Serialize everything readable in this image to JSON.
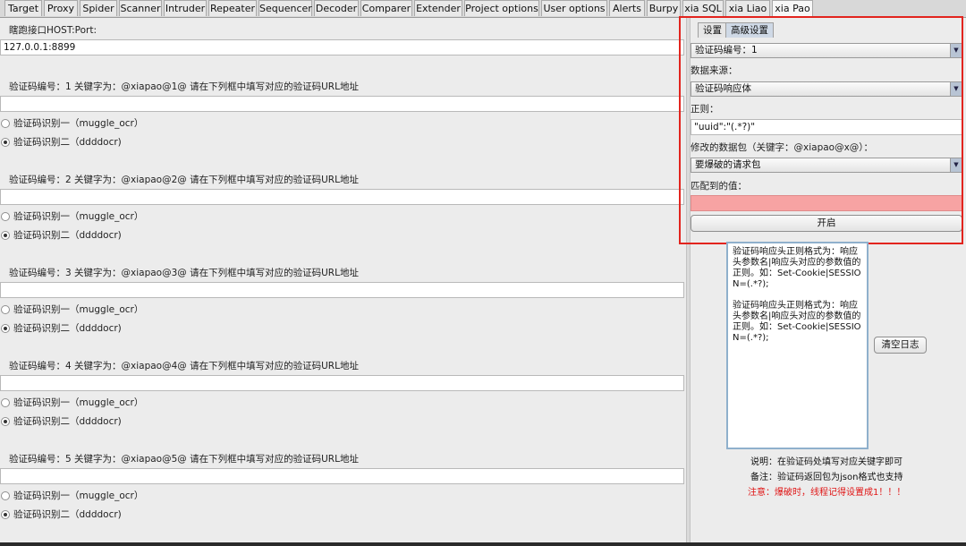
{
  "tabs": [
    "Target",
    "Proxy",
    "Spider",
    "Scanner",
    "Intruder",
    "Repeater",
    "Sequencer",
    "Decoder",
    "Comparer",
    "Extender",
    "Project options",
    "User options",
    "Alerts",
    "Burpy",
    "xia SQL",
    "xia Liao",
    "xia Pao"
  ],
  "active_tab": "xia Pao",
  "left": {
    "host_label": "瞎跑接口HOST:Port:",
    "host_value": "127.0.0.1:8899",
    "sections": [
      {
        "title": "验证码编号：1  关键字为：@xiapao@1@    请在下列框中填写对应的验证码URL地址",
        "url": "",
        "opt1": "验证码识别一（muggle_ocr）",
        "opt2": "验证码识别二（ddddocr)"
      },
      {
        "title": "验证码编号：2  关键字为：@xiapao@2@    请在下列框中填写对应的验证码URL地址",
        "url": "",
        "opt1": "验证码识别一（muggle_ocr）",
        "opt2": "验证码识别二（ddddocr)"
      },
      {
        "title": "验证码编号：3  关键字为：@xiapao@3@    请在下列框中填写对应的验证码URL地址",
        "url": "",
        "opt1": "验证码识别一（muggle_ocr）",
        "opt2": "验证码识别二（ddddocr)"
      },
      {
        "title": "验证码编号：4  关键字为：@xiapao@4@    请在下列框中填写对应的验证码URL地址",
        "url": "",
        "opt1": "验证码识别一（muggle_ocr）",
        "opt2": "验证码识别二（ddddocr)"
      },
      {
        "title": "验证码编号：5  关键字为：@xiapao@5@    请在下列框中填写对应的验证码URL地址",
        "url": "",
        "opt1": "验证码识别一（muggle_ocr）",
        "opt2": "验证码识别二（ddddocr)"
      }
    ]
  },
  "right": {
    "subtabs": [
      "设置",
      "高级设置"
    ],
    "active_subtab": "高级设置",
    "captcha_select": "验证码编号：1",
    "source_label": "数据来源：",
    "source_select": "验证码响应体",
    "regex_label": "正则：",
    "regex_value": "\"uuid\":\"(.*?)\"",
    "packet_label": "修改的数据包（关键字：@xiapao@x@）：",
    "packet_select": "要爆破的请求包",
    "match_label": "匹配到的值：",
    "match_value": "",
    "start_button": "开启",
    "log_lines": [
      "验证码响应头正则格式为：响应头参数名|响应头对应的参数值的正则。如：Set-Cookie|SESSION=(.*?);",
      "验证码响应头正则格式为：响应头参数名|响应头对应的参数值的正则。如：Set-Cookie|SESSION=(.*?);"
    ],
    "clear_button": "清空日志",
    "note1": "说明：在验证码处填写对应关键字即可",
    "note2": "备注：验证码返回包为json格式也支持",
    "note3": "注意：爆破时，线程记得设置成1！！！"
  },
  "colors": {
    "highlight": "#e2241e",
    "warning": "#e01515",
    "match_fill": "#f7a3a3"
  }
}
